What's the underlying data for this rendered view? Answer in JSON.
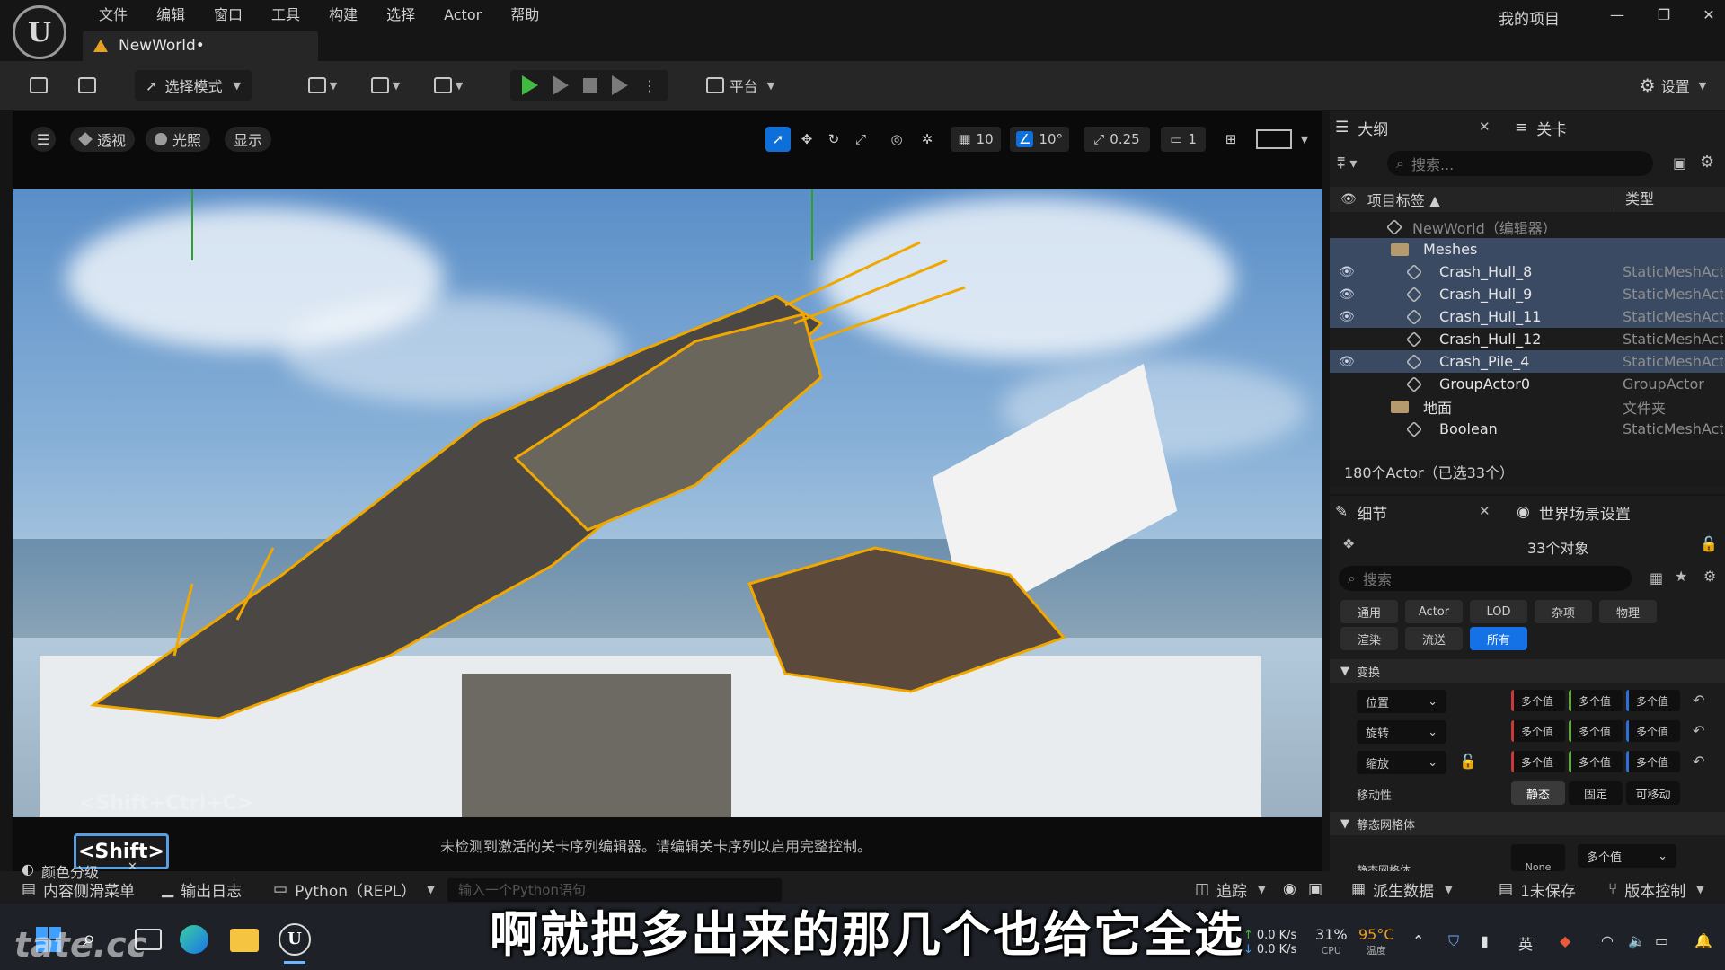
{
  "app": {
    "logo": "U",
    "project_name": "我的项目"
  },
  "menu": [
    "文件",
    "编辑",
    "窗口",
    "工具",
    "构建",
    "选择",
    "Actor",
    "帮助"
  ],
  "window_controls": {
    "minimize": "—",
    "restore": "❐",
    "close": "✕"
  },
  "level_tab": {
    "title": "NewWorld•"
  },
  "toolbar": {
    "mode_label": "选择模式",
    "platform_label": "平台",
    "settings_label": "设置"
  },
  "viewport": {
    "menu_icon": "hamburger-icon",
    "perspective_label": "透视",
    "lighting_label": "光照",
    "show_label": "显示",
    "grid_snap": "10",
    "rotation_snap": "10°",
    "scale_snap": "0.25",
    "camera_speed": "1",
    "shift_badge": "<Shift>",
    "message": "未检测到激活的关卡序列编辑器。请编辑关卡序列以启用完整控制。",
    "faint_overlay": "<Shift+Ctrl+C>"
  },
  "outliner": {
    "tab_label": "大纲",
    "tab2_label": "关卡",
    "search_placeholder": "搜索...",
    "col_label": "项目标签 ▲",
    "col_type": "类型",
    "rows": [
      {
        "name": "NewWorld（编辑器）",
        "type": "",
        "selected": false,
        "eye": false,
        "icon": "world"
      },
      {
        "name": "Meshes",
        "type": "",
        "selected": true,
        "eye": false,
        "icon": "folder"
      },
      {
        "name": "Crash_Hull_8",
        "type": "StaticMeshActor",
        "selected": true,
        "eye": true,
        "icon": "mesh"
      },
      {
        "name": "Crash_Hull_9",
        "type": "StaticMeshActor",
        "selected": true,
        "eye": true,
        "icon": "mesh"
      },
      {
        "name": "Crash_Hull_11",
        "type": "StaticMeshActor",
        "selected": true,
        "eye": true,
        "icon": "mesh"
      },
      {
        "name": "Crash_Hull_12",
        "type": "StaticMeshActor",
        "selected": false,
        "eye": false,
        "icon": "mesh"
      },
      {
        "name": "Crash_Pile_4",
        "type": "StaticMeshActor",
        "selected": true,
        "eye": true,
        "icon": "mesh"
      },
      {
        "name": "GroupActor0",
        "type": "GroupActor",
        "selected": false,
        "eye": false,
        "icon": "group"
      },
      {
        "name": "地面",
        "type": "文件夹",
        "selected": false,
        "eye": false,
        "icon": "folder"
      },
      {
        "name": "Boolean",
        "type": "StaticMeshActor",
        "selected": false,
        "eye": false,
        "icon": "mesh"
      }
    ],
    "actor_count": "180个Actor（已选33个）"
  },
  "details": {
    "tab_label": "细节",
    "tab2_label": "世界场景设置",
    "object_count": "33个对象",
    "search_placeholder": "搜索",
    "filters_row1": [
      "通用",
      "Actor",
      "LOD",
      "杂项",
      "物理"
    ],
    "filters_row2": [
      "渲染",
      "流送",
      "所有"
    ],
    "section_transform": "变换",
    "location": "位置",
    "rotation": "旋转",
    "scale": "缩放",
    "multi": "多个值",
    "mobility_label": "移动性",
    "mobility_options": [
      "静态",
      "固定",
      "可移动"
    ],
    "section_static_mesh": "静态网格体",
    "static_mesh_label": "静态网格体",
    "static_mesh_none": "None",
    "static_mesh_value": "多个值"
  },
  "statusbar": {
    "content_drawer": "内容侧滑菜单",
    "color_grading": "颜色分级",
    "output_log": "输出日志",
    "python": "Python（REPL）",
    "python_placeholder": "输入一个Python语句",
    "trace": "追踪",
    "derived_data": "派生数据",
    "unsaved": "1未保存",
    "source_control": "版本控制"
  },
  "taskbar": {
    "net_up": "0.0",
    "net_down": "0.0",
    "net_unit": "K/s",
    "cpu_value": "31%",
    "cpu_label": "CPU",
    "temp_value": "95°C",
    "temp_label": "温度",
    "ime": "英"
  },
  "subtitle": "啊就把多出来的那几个也给它全选",
  "watermark": "tate.cc",
  "colors": {
    "accent": "#1472e6",
    "selection_outline": "#f0a800",
    "play_green": "#3fbb3f"
  }
}
